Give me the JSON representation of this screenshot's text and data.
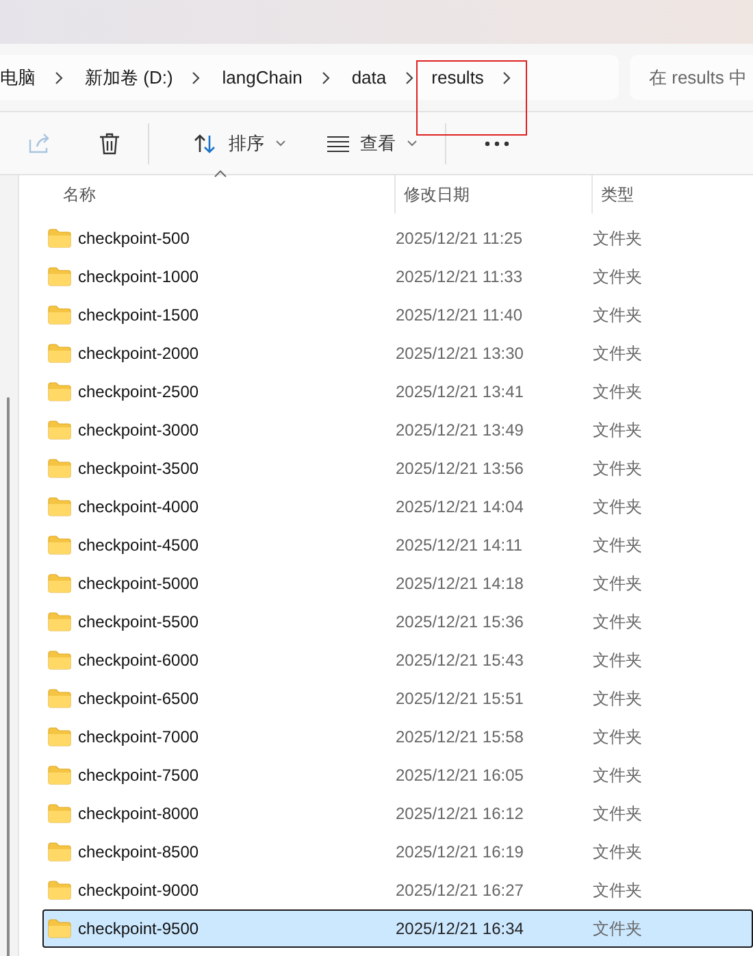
{
  "address_bar": {
    "breadcrumbs": [
      {
        "label": "电脑",
        "highlighted": false
      },
      {
        "label": "新加卷 (D:)",
        "highlighted": false
      },
      {
        "label": "langChain",
        "highlighted": false
      },
      {
        "label": "data",
        "highlighted": false
      },
      {
        "label": "results",
        "highlighted": true
      }
    ],
    "search": {
      "placeholder": "在 results 中"
    }
  },
  "toolbar": [
    {
      "kind": "share",
      "disabled": true
    },
    {
      "kind": "delete",
      "disabled": false
    },
    {
      "kind": "sort",
      "label": "排序",
      "disabled": false
    },
    {
      "kind": "view",
      "label": "查看",
      "disabled": false
    },
    {
      "kind": "more",
      "disabled": false
    }
  ],
  "table": {
    "columns": [
      {
        "label": "名称",
        "sorted": true
      },
      {
        "label": "修改日期",
        "sorted": false
      },
      {
        "label": "类型",
        "sorted": false
      }
    ],
    "rows": [
      {
        "name": "checkpoint-500",
        "date": "2025/12/21 11:25",
        "type": "文件夹",
        "selected": false
      },
      {
        "name": "checkpoint-1000",
        "date": "2025/12/21 11:33",
        "type": "文件夹",
        "selected": false
      },
      {
        "name": "checkpoint-1500",
        "date": "2025/12/21 11:40",
        "type": "文件夹",
        "selected": false
      },
      {
        "name": "checkpoint-2000",
        "date": "2025/12/21 13:30",
        "type": "文件夹",
        "selected": false
      },
      {
        "name": "checkpoint-2500",
        "date": "2025/12/21 13:41",
        "type": "文件夹",
        "selected": false
      },
      {
        "name": "checkpoint-3000",
        "date": "2025/12/21 13:49",
        "type": "文件夹",
        "selected": false
      },
      {
        "name": "checkpoint-3500",
        "date": "2025/12/21 13:56",
        "type": "文件夹",
        "selected": false
      },
      {
        "name": "checkpoint-4000",
        "date": "2025/12/21 14:04",
        "type": "文件夹",
        "selected": false
      },
      {
        "name": "checkpoint-4500",
        "date": "2025/12/21 14:11",
        "type": "文件夹",
        "selected": false
      },
      {
        "name": "checkpoint-5000",
        "date": "2025/12/21 14:18",
        "type": "文件夹",
        "selected": false
      },
      {
        "name": "checkpoint-5500",
        "date": "2025/12/21 15:36",
        "type": "文件夹",
        "selected": false
      },
      {
        "name": "checkpoint-6000",
        "date": "2025/12/21 15:43",
        "type": "文件夹",
        "selected": false
      },
      {
        "name": "checkpoint-6500",
        "date": "2025/12/21 15:51",
        "type": "文件夹",
        "selected": false
      },
      {
        "name": "checkpoint-7000",
        "date": "2025/12/21 15:58",
        "type": "文件夹",
        "selected": false
      },
      {
        "name": "checkpoint-7500",
        "date": "2025/12/21 16:05",
        "type": "文件夹",
        "selected": false
      },
      {
        "name": "checkpoint-8000",
        "date": "2025/12/21 16:12",
        "type": "文件夹",
        "selected": false
      },
      {
        "name": "checkpoint-8500",
        "date": "2025/12/21 16:19",
        "type": "文件夹",
        "selected": false
      },
      {
        "name": "checkpoint-9000",
        "date": "2025/12/21 16:27",
        "type": "文件夹",
        "selected": false
      },
      {
        "name": "checkpoint-9500",
        "date": "2025/12/21 16:34",
        "type": "文件夹",
        "selected": true
      }
    ]
  }
}
